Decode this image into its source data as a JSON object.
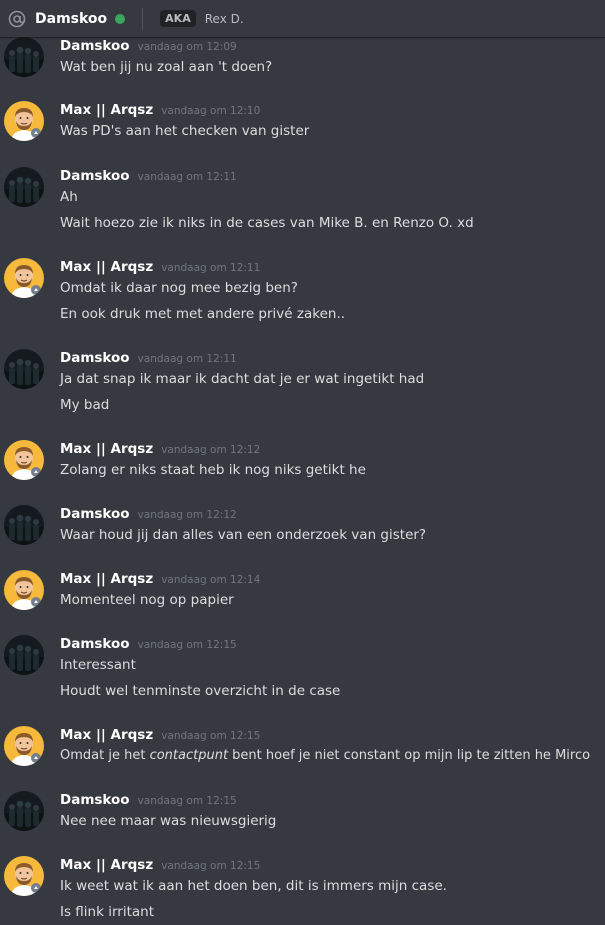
{
  "header": {
    "title": "Damskoo",
    "aka_badge": "AKA",
    "aka_name": "Rex D.",
    "icon": "at-icon",
    "status": "online",
    "status_color": "#3ba55d"
  },
  "colors": {
    "background": "#36393f",
    "author": "#ffffff",
    "timestamp": "#72767d",
    "text": "#dcddde",
    "max_avatar_bg": "#f6b93b"
  },
  "messages": [
    {
      "author": "Damskoo",
      "timestamp": "vandaag om 12:09",
      "lines": [
        "Wat ben jij nu zoal aan 't doen?"
      ]
    },
    {
      "author": "Max || Arqsz",
      "timestamp": "vandaag om 12:10",
      "lines": [
        "Was PD's aan het checken van gister"
      ]
    },
    {
      "author": "Damskoo",
      "timestamp": "vandaag om 12:11",
      "lines": [
        "Ah",
        "Wait hoezo zie ik niks in de cases van Mike B. en Renzo O. xd"
      ]
    },
    {
      "author": "Max || Arqsz",
      "timestamp": "vandaag om 12:11",
      "lines": [
        "Omdat ik daar nog mee bezig ben?",
        "En ook druk met met andere privé zaken.."
      ]
    },
    {
      "author": "Damskoo",
      "timestamp": "vandaag om 12:11",
      "lines": [
        "Ja dat snap ik maar ik dacht dat je er wat ingetikt had",
        "My bad"
      ]
    },
    {
      "author": "Max || Arqsz",
      "timestamp": "vandaag om 12:12",
      "lines": [
        "Zolang er niks staat heb ik nog niks getikt he"
      ]
    },
    {
      "author": "Damskoo",
      "timestamp": "vandaag om 12:12",
      "lines": [
        "Waar houd jij dan alles van een onderzoek van gister?"
      ]
    },
    {
      "author": "Max || Arqsz",
      "timestamp": "vandaag om 12:14",
      "lines": [
        "Momenteel nog op papier"
      ]
    },
    {
      "author": "Damskoo",
      "timestamp": "vandaag om 12:15",
      "lines": [
        "Interessant",
        "Houdt wel tenminste overzicht in de case"
      ]
    },
    {
      "author": "Max || Arqsz",
      "timestamp": "vandaag om 12:15",
      "lines": [
        [
          "Omdat je het ",
          "contactpunt",
          " bent hoef je niet constant op mijn lip te zitten he Mirco"
        ]
      ]
    },
    {
      "author": "Damskoo",
      "timestamp": "vandaag om 12:15",
      "lines": [
        "Nee nee maar was nieuwsgierig"
      ]
    },
    {
      "author": "Max || Arqsz",
      "timestamp": "vandaag om 12:15",
      "lines": [
        "Ik weet wat ik aan het doen ben, dit is immers mijn case.",
        "Is flink irritant"
      ]
    }
  ]
}
